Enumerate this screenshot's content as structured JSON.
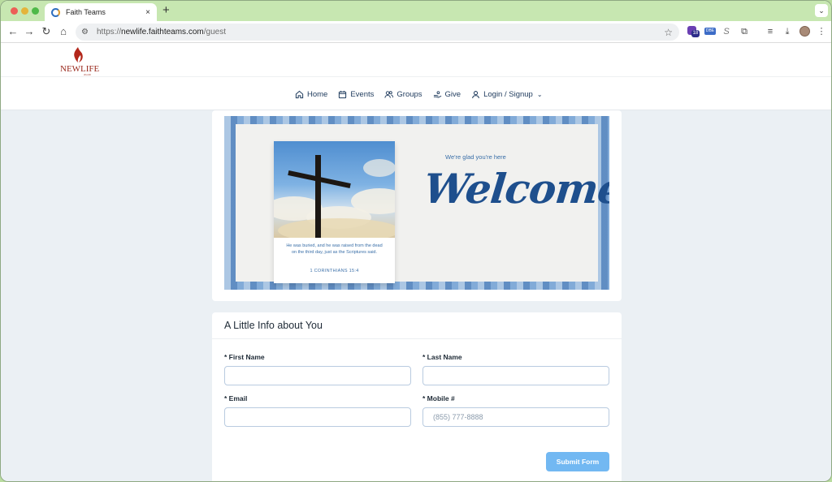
{
  "browser": {
    "tab_title": "Faith Teams",
    "tab_close": "×",
    "new_tab": "+",
    "tab_dropdown": "⌄",
    "url_protocol": "https://",
    "url_host": "newlife.faithteams.com",
    "url_path": "/guest",
    "back_icon": "←",
    "forward_icon": "→",
    "reload_icon": "↻",
    "home_icon": "⌂",
    "star_icon": "☆",
    "ext_badge_count": "18",
    "ext_box_label": "DBE",
    "ext_s_label": "S",
    "puzzle_icon": "⧉",
    "reading_list_icon": "≡",
    "download_icon": "⤓",
    "menu_icon": "⋮"
  },
  "site": {
    "logo_text": "NEWLIFE",
    "logo_sub": "church",
    "brand_color": "#9a2a1e",
    "accent_color": "#1e4f8d",
    "nav": [
      {
        "label": "Home",
        "icon": "home-icon"
      },
      {
        "label": "Events",
        "icon": "calendar-icon"
      },
      {
        "label": "Groups",
        "icon": "users-icon"
      },
      {
        "label": "Give",
        "icon": "hand-coin-icon"
      },
      {
        "label": "Login / Signup",
        "icon": "user-icon"
      }
    ]
  },
  "banner": {
    "glad_text": "We're glad you're here",
    "welcome_text": "Welcome!",
    "verse_text": "He was buried, and he was raised from the dead on the third day, just as the Scriptures said.",
    "verse_ref": "1 CORINTHIANS 15:4"
  },
  "form": {
    "title": "A Little Info about You",
    "first_name_label": "* First Name",
    "last_name_label": "* Last Name",
    "email_label": "* Email",
    "mobile_label": "* Mobile #",
    "first_name_value": "",
    "last_name_value": "",
    "email_value": "",
    "mobile_value": "",
    "mobile_placeholder": "(855) 777-8888",
    "submit_label": "Submit Form"
  }
}
